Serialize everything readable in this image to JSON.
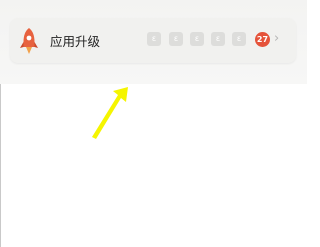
{
  "upgrade_card": {
    "title": "应用升级",
    "app_icon_glyphs": [
      "ε",
      "ε",
      "ε",
      "ε",
      "ε"
    ],
    "badge_count": "27",
    "icon": "rocket-icon",
    "accent_color": "#e5533a"
  },
  "annotation": {
    "icon": "yellow-arrow-icon",
    "color": "#f5f500"
  }
}
